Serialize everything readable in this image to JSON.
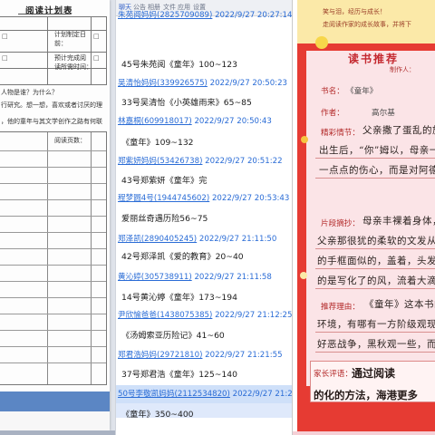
{
  "plan": {
    "title": "阅读计划表",
    "row1_label": "计划制定日",
    "row1_label2": "前：",
    "row2_label": "预计完成阅",
    "row2_label2": "读所需时间：",
    "question1": "人物是谁？为什么？",
    "question2": "行研究。想一想，喜欢或者讨厌的理",
    "question3": "，他的童年与其文学创作之路有何联",
    "pages_label": "阅读页数：",
    "checkbox_glyph": "□"
  },
  "chat": {
    "tabs": [
      "聊天",
      "公告",
      "相册",
      "文件",
      "应用",
      "设置"
    ],
    "messages": [
      {
        "sender": "朱苑阅妈妈(2825709089)",
        "time": "2022/9/27 20:27:14",
        "text": "45号朱苑阅《童年》100~123"
      },
      {
        "sender": "吴清怡妈妈(339926575)",
        "time": "2022/9/27 20:50:23",
        "text": "33号吴清怡《小英雄雨来》65~85"
      },
      {
        "sender": "林嘉桐(609918017)",
        "time": "2022/9/27 20:50:43",
        "text": "《童年》109~132"
      },
      {
        "sender": "郑紫妍妈妈(53426738)",
        "time": "2022/9/27 20:51:22",
        "text": "43号郑紫妍《童年》完"
      },
      {
        "sender": "程梦圆4号(1944745602)",
        "time": "2022/9/27 20:53:43",
        "text": "爱丽丝奇遇历险56~75"
      },
      {
        "sender": "郑泽凯(2890405245)",
        "time": "2022/9/27 21:11:50",
        "text": "42号郑泽凯《爱的教育》20~40"
      },
      {
        "sender": "黄沁婷(305738911)",
        "time": "2022/9/27 21:11:58",
        "text": "14号黄沁婷《童年》173~194"
      },
      {
        "sender": "尹欣愉爸爸(1438075385)",
        "time": "2022/9/27 21:12:25",
        "text": "《汤姆索亚历险记》41~60"
      },
      {
        "sender": "郑君浩妈妈(29721810)",
        "time": "2022/9/27 21:21:55",
        "text": "37号郑君浩《童年》125~140"
      },
      {
        "sender": "50号李敬凯妈妈(2112534820)",
        "time": "2022/9/27 21:24:00",
        "text": "《童年》350~400"
      }
    ]
  },
  "card": {
    "note_line1": "笑与泪，经历与成长！",
    "note_line2": "走阅读作家的成长故事，并将下",
    "title": "读书推荐",
    "maker": "制作人：",
    "book_label": "书名：",
    "book_value": "《童年》",
    "author_label": "作者：",
    "author_value": "高尔基",
    "highlight_label": "精彩情节：",
    "highlight_lines": [
      "父亲撒了蛋乱的施",
      "出生后，“你”姆以，母亲一起去",
      "一点点的伤心，而是对阿德的"
    ],
    "excerpt_label": "片段摘抄：",
    "excerpt_lines": [
      "母亲丰裸着身体，窗",
      "父亲那很犹的柔软的文发从前",
      "的手框面似的，盖着，头发也流",
      "的是写化了的风，流着大滴"
    ],
    "reason_label": "推荐理由：",
    "reason_lines": [
      "《童年》这本书的",
      "环境，有哪有一方阶级观现，",
      "好恶战争，黑秋观一些，而且更"
    ],
    "review_label": "家长评语：",
    "review_hw": "通过阅读",
    "review_hw2": "的化的方法，海港更多"
  }
}
